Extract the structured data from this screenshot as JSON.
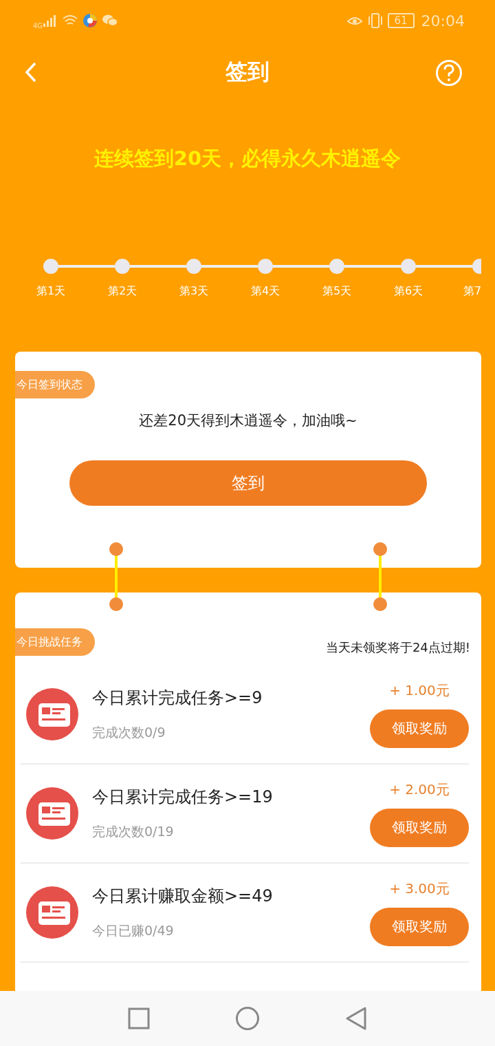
{
  "status_bar": {
    "network": "4G",
    "battery": "61",
    "time": "20:04"
  },
  "header": {
    "title": "签到"
  },
  "banner": "连续签到20天，必得永久木逍遥令",
  "days": [
    {
      "label": "第1天"
    },
    {
      "label": "第2天"
    },
    {
      "label": "第3天"
    },
    {
      "label": "第4天"
    },
    {
      "label": "第5天"
    },
    {
      "label": "第6天"
    },
    {
      "label": "第7"
    }
  ],
  "status_card": {
    "tag": "今日签到状态",
    "message": "还差20天得到木逍遥令，加油哦~",
    "button": "签到"
  },
  "task_card": {
    "tag": "今日挑战任务",
    "notice": "当天未领奖将于24点过期!",
    "tasks": [
      {
        "title": "今日累计完成任务>=9",
        "progress": "完成次数0/9",
        "level": 0,
        "reward": "+ 1.00元",
        "button": "领取奖励"
      },
      {
        "title": "今日累计完成任务>=19",
        "progress": "完成次数0/19",
        "level": 0,
        "reward": "+ 2.00元",
        "button": "领取奖励"
      },
      {
        "title": "今日累计赚取金额>=49",
        "progress": "今日已赚0/49",
        "level": 0,
        "reward": "+ 3.00元",
        "button": "领取奖励"
      }
    ]
  }
}
